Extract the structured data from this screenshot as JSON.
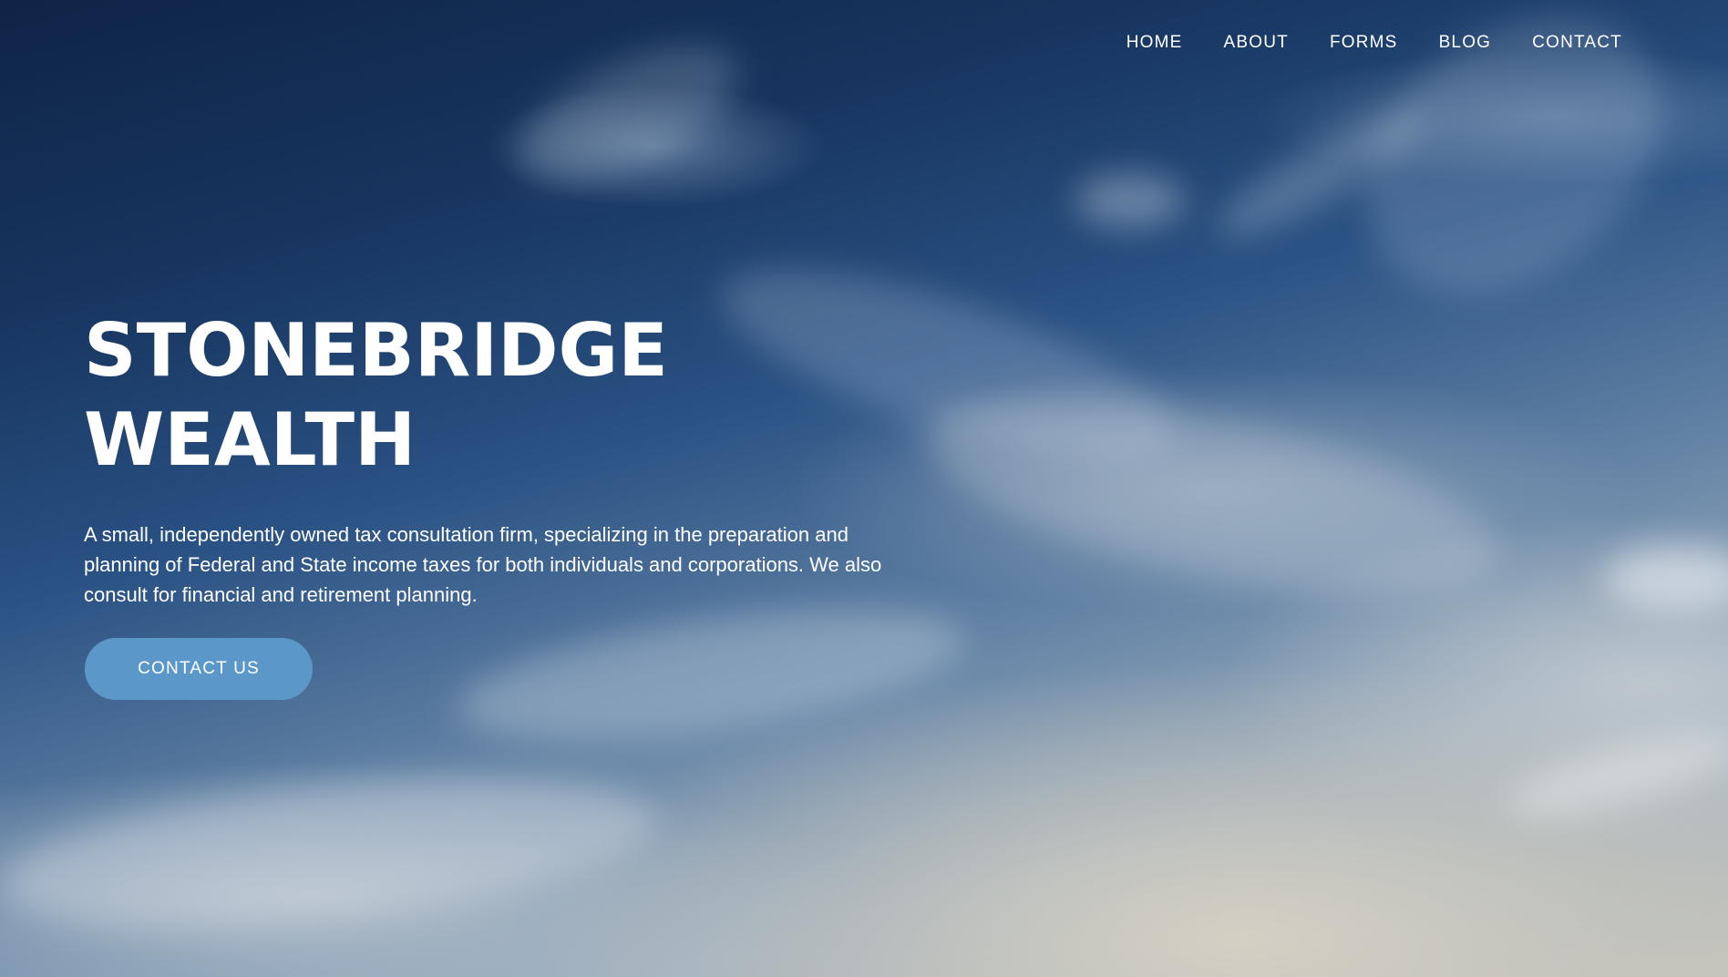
{
  "nav": {
    "items": [
      {
        "label": "HOME"
      },
      {
        "label": "ABOUT"
      },
      {
        "label": "FORMS"
      },
      {
        "label": "BLOG"
      },
      {
        "label": "CONTACT"
      }
    ]
  },
  "hero": {
    "title_line1": "STONEBRIDGE",
    "title_line2": "WEALTH",
    "tagline": "A small, independently owned tax consultation firm, specializing in the preparation and planning of Federal and State income taxes for both individuals and corporations. We also consult for financial and retirement planning.",
    "cta_label": "CONTACT US",
    "background": "sky-with-clouds-image"
  },
  "colors": {
    "cta_background": "#5b98c9",
    "text": "#ffffff",
    "sky_top": "#0f2447"
  }
}
